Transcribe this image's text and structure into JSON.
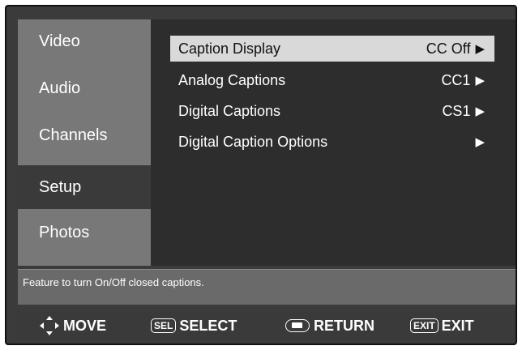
{
  "sidebar": {
    "items": [
      {
        "label": "Video"
      },
      {
        "label": "Audio"
      },
      {
        "label": "Channels"
      },
      {
        "label": "Setup"
      },
      {
        "label": "Photos"
      }
    ]
  },
  "menu": {
    "items": [
      {
        "label": "Caption Display",
        "value": "CC Off"
      },
      {
        "label": "Analog Captions",
        "value": "CC1"
      },
      {
        "label": "Digital Captions",
        "value": "CS1"
      },
      {
        "label": "Digital Caption Options",
        "value": ""
      }
    ]
  },
  "help_text": "Feature to turn On/Off closed captions.",
  "actions": {
    "move": "MOVE",
    "select_key": "SEL",
    "select": "SELECT",
    "return": "RETURN",
    "exit_key": "EXIT",
    "exit": "EXIT"
  },
  "icons": {
    "move": "four-way-arrow-icon",
    "return": "return-button-icon",
    "submenu": "right-triangle-icon"
  }
}
